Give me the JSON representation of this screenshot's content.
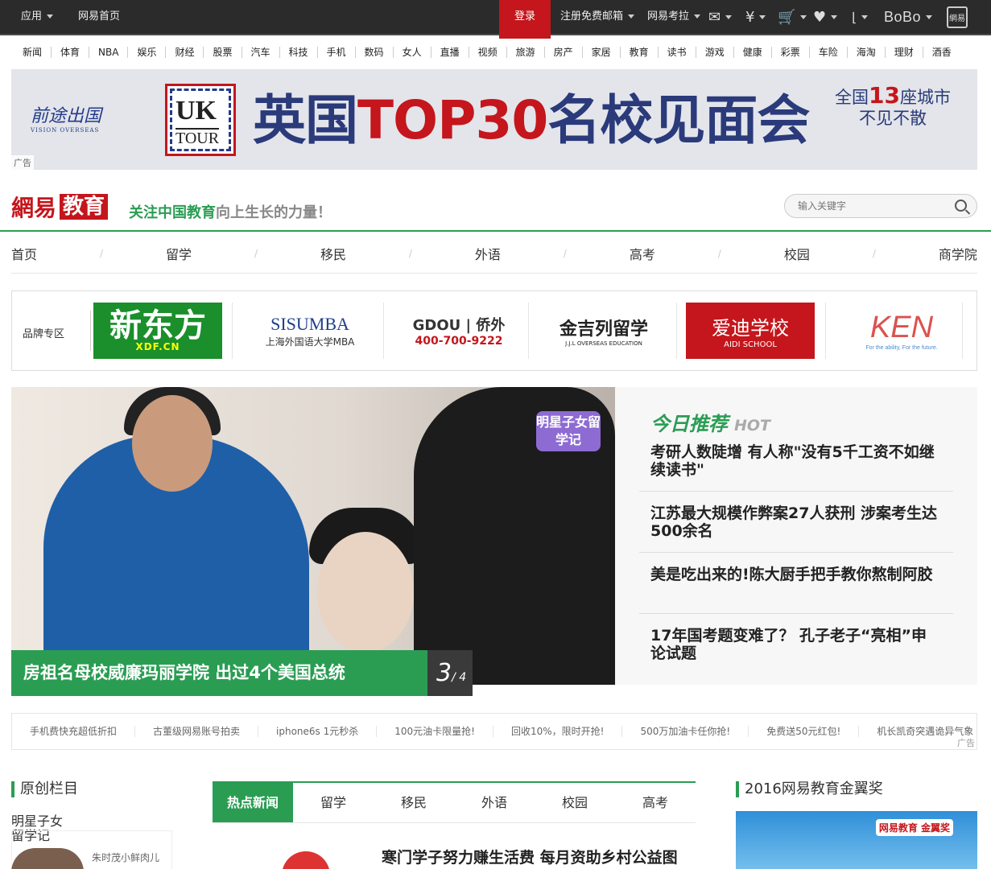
{
  "topbar": {
    "apps": "应用",
    "home": "网易首页",
    "login": "登录",
    "register": "注册免费邮箱",
    "kaola": "网易考拉",
    "mail_icon": "mail-icon",
    "pay_icon": "yuan-icon",
    "cart_icon": "cart-icon",
    "fav_icon": "heart-icon",
    "bobo": "BoBo",
    "mobile": "網易"
  },
  "channels": [
    "新闻",
    "体育",
    "NBA",
    "娱乐",
    "财经",
    "股票",
    "汽车",
    "科技",
    "手机",
    "数码",
    "女人",
    "直播",
    "视频",
    "旅游",
    "房产",
    "家居",
    "教育",
    "读书",
    "游戏",
    "健康",
    "彩票",
    "车险",
    "海淘",
    "理财",
    "酒香"
  ],
  "banner": {
    "brand": "前途出国",
    "brand_en": "VISION OVERSEAS",
    "uk_top": "UK",
    "uk_bottom": "TOUR",
    "headline_a": "英国",
    "headline_b": "TOP30",
    "headline_c": "名校见面会",
    "cities_a": "全国",
    "cities_num": "13",
    "cities_b": "座城市",
    "cities_c": "不见不散",
    "ad": "广告"
  },
  "header": {
    "logo_netease": "網易",
    "logo_edu": "教育",
    "slogan_green": "关注中国教育",
    "slogan_gray": "向上生长的力量！",
    "search_placeholder": "输入关键字"
  },
  "mainnav": [
    "首页",
    "留学",
    "移民",
    "外语",
    "高考",
    "校园",
    "商学院"
  ],
  "brands": {
    "label": "品牌专区",
    "xdf": "新东方",
    "xdf_sub": "XDF.CN",
    "sisu": "SISUMBA",
    "sisu_sub": "上海外国语大学MBA",
    "gdou": "GDOU | 侨外",
    "gdou_phone": "400-700-9222",
    "jjl": "金吉列留学",
    "jjl_sub": "J.J.L OVERSEAS EDUCATION",
    "aidi": "爱迪学校",
    "aidi_sub": "AIDI SCHOOL",
    "ken": "KEN",
    "ken_sub": "For the ability, For the future."
  },
  "hero": {
    "tag": "明星子女留学记",
    "caption": "房祖名母校威廉玛丽学院 出过4个美国总统",
    "current": "3",
    "total": "/ 4"
  },
  "hot": {
    "title": "今日推荐",
    "title_en": "HOT",
    "items": [
      "考研人数陡增 有人称\"没有5千工资不如继续读书\"",
      "江苏最大规模作弊案27人获刑 涉案考生达500余名",
      "美是吃出来的!陈大厨手把手教你熬制阿胶",
      "17年国考题变难了？ 孔子老子“亮相”申论试题"
    ]
  },
  "strip": {
    "items": [
      "手机费快充超低折扣",
      "古董级网易账号拍卖",
      "iphone6s 1元秒杀",
      "100元油卡限量抢!",
      "回收10%，限时开抢!",
      "500万加油卡任你抢!",
      "免费送50元红包!",
      "机长凯奇突遇诡异气象"
    ],
    "ad": "广告"
  },
  "sections": {
    "original": "原创栏目",
    "original_sub": "明星子女留学记",
    "thumb_caption": "朱时茂小鲜肉儿",
    "tabs": [
      "热点新闻",
      "留学",
      "移民",
      "外语",
      "校园",
      "高考"
    ],
    "news_headline": "寒门学子努力赚生活费 每月资助乡村公益图",
    "award": "2016网易教育金翼奖",
    "award_badge": "网易教育 金翼奖"
  }
}
